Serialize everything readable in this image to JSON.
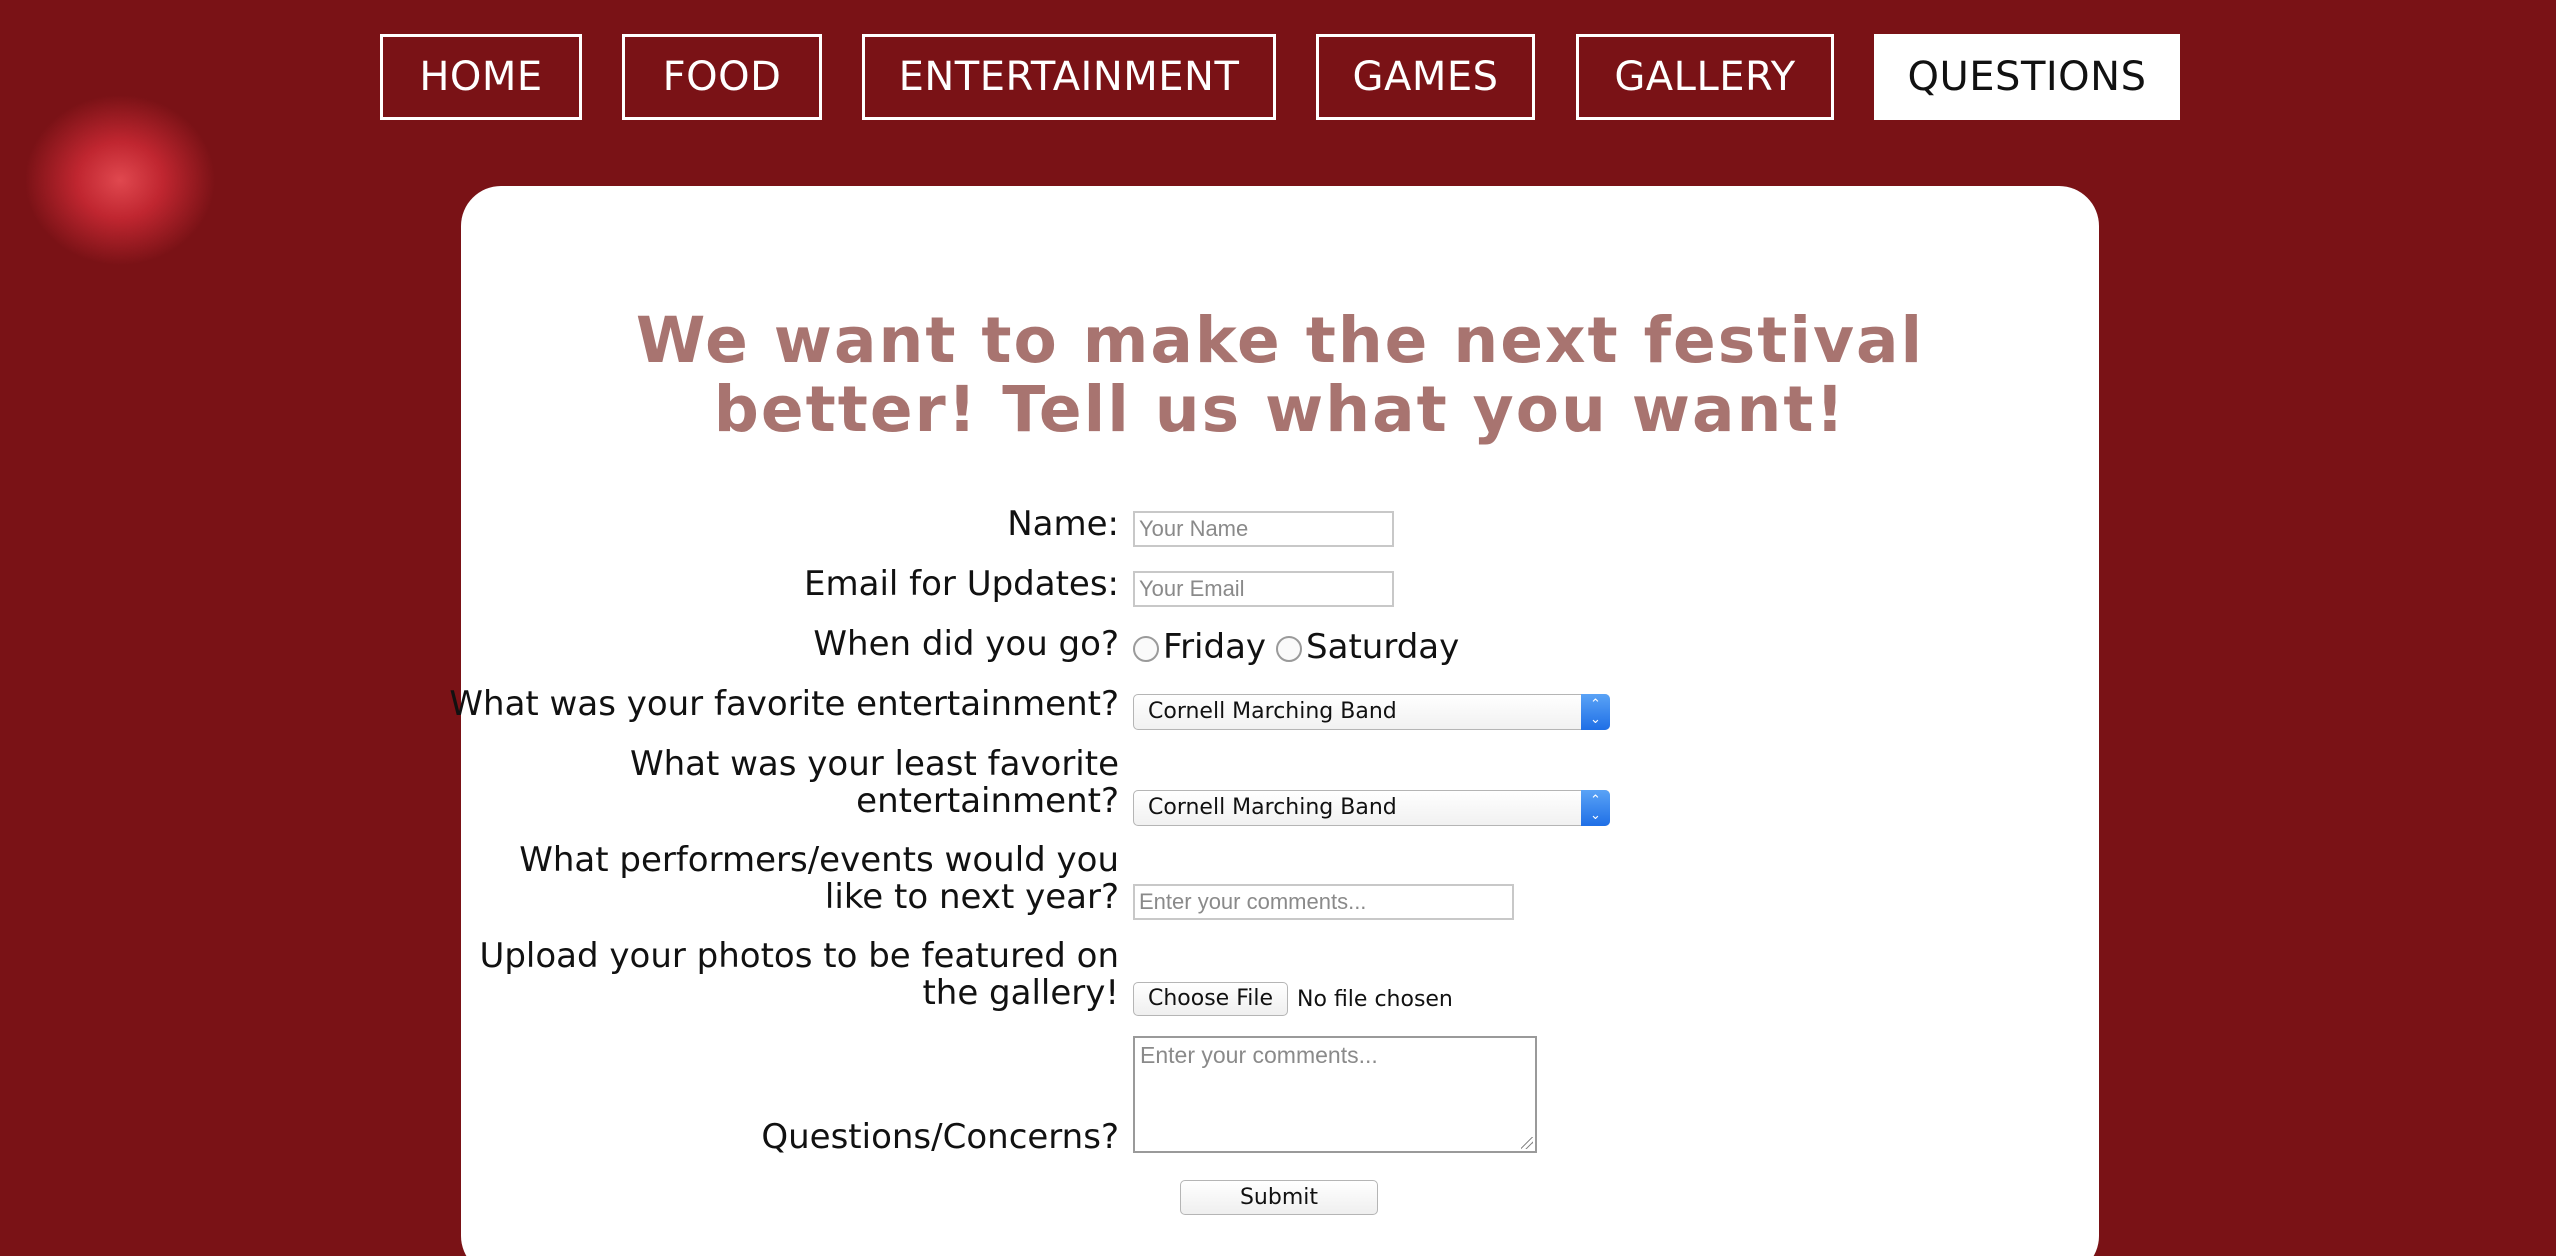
{
  "nav": {
    "items": [
      {
        "label": "HOME",
        "active": false
      },
      {
        "label": "FOOD",
        "active": false
      },
      {
        "label": "ENTERTAINMENT",
        "active": false
      },
      {
        "label": "GAMES",
        "active": false
      },
      {
        "label": "GALLERY",
        "active": false
      },
      {
        "label": "QUESTIONS",
        "active": true
      }
    ]
  },
  "form": {
    "title": "We want to make the next festival better! Tell us what you want!",
    "name": {
      "label": "Name:",
      "placeholder": "Your Name",
      "value": ""
    },
    "email": {
      "label": "Email for Updates:",
      "placeholder": "Your Email",
      "value": ""
    },
    "visit_day": {
      "label": "When did you go?",
      "options": [
        "Friday",
        "Saturday"
      ],
      "selected": ""
    },
    "favorite": {
      "label": "What was your favorite entertainment?",
      "selected": "Cornell Marching Band"
    },
    "least_favorite": {
      "label_line1": "What was your least favorite",
      "label_line2": "entertainment?",
      "selected": "Cornell Marching Band"
    },
    "performers": {
      "label_line1": "What performers/events would you",
      "label_line2": "like to next year?",
      "placeholder": "Enter your comments...",
      "value": ""
    },
    "upload": {
      "label_line1": "Upload your photos to be featured on",
      "label_line2": "the gallery!",
      "button_label": "Choose File",
      "status": "No file chosen"
    },
    "questions": {
      "label": "Questions/Concerns?",
      "placeholder": "Enter your comments...",
      "value": ""
    },
    "submit_label": "Submit"
  },
  "colors": {
    "title": "#a87470",
    "panel": "#ffffff",
    "nav_active_bg": "#ffffff",
    "select_arrow": "#2f80ed"
  }
}
